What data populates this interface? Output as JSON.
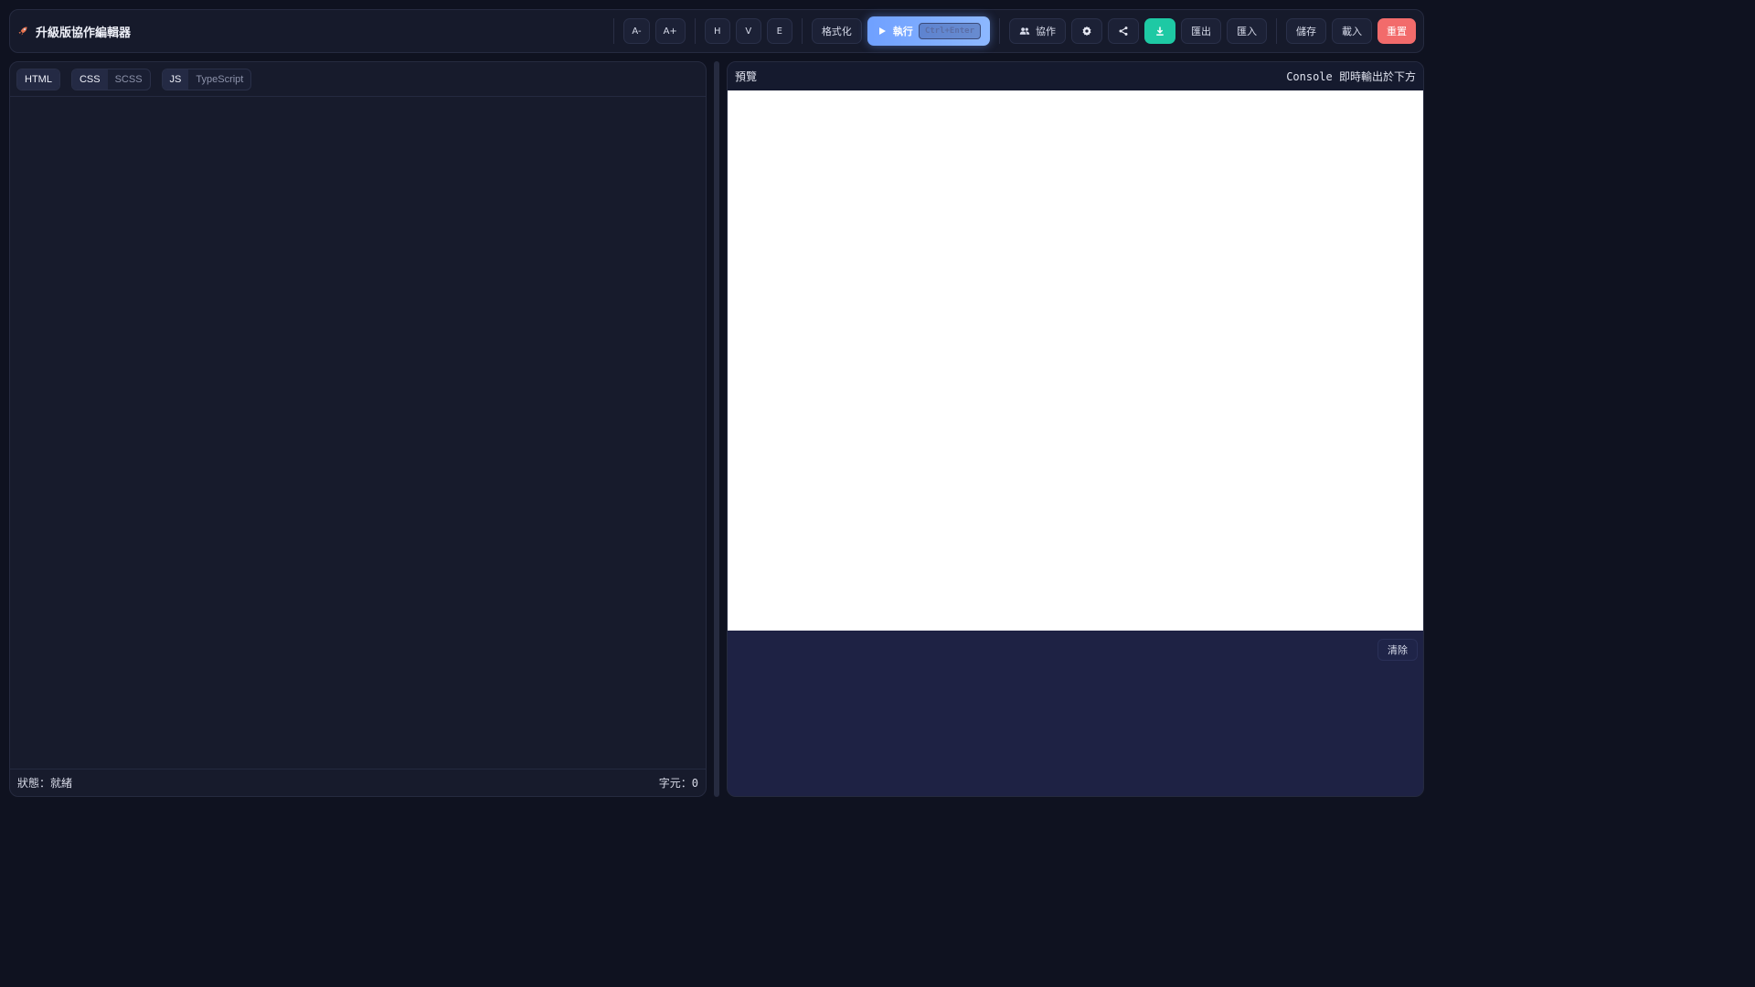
{
  "app": {
    "title": "升級版協作編輯器",
    "logo_icon": "rocket-icon"
  },
  "toolbar": {
    "font_decrease": "A-",
    "font_increase": "A+",
    "layout_h": "H",
    "layout_v": "V",
    "layout_e": "E",
    "format": "格式化",
    "run_label": "執行",
    "run_shortcut": "Ctrl+Enter",
    "collab": "協作",
    "settings_icon": "gear-icon",
    "share_icon": "share-icon",
    "download_icon": "download-icon",
    "export": "匯出",
    "import": "匯入",
    "save": "儲存",
    "load": "載入",
    "reset": "重置"
  },
  "editor": {
    "tabs": {
      "html": "HTML",
      "css": "CSS",
      "scss": "SCSS",
      "js": "JS",
      "typescript": "TypeScript"
    },
    "status": "狀態：就緒",
    "char_count": "字元：0"
  },
  "preview": {
    "title": "預覽",
    "console_hint": "Console 即時輸出於下方",
    "clear": "清除"
  },
  "colors": {
    "background": "#0f1220",
    "accent_run": "#6fa0ff",
    "download_green": "#1ec9a4",
    "reset_red": "#f26b6b"
  }
}
